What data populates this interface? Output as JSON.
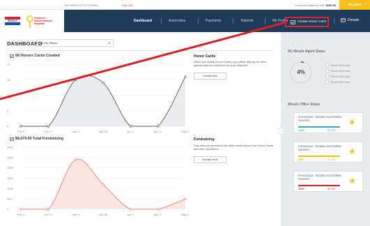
{
  "topbar": {
    "system_label": "THE MIRACLE SYSTEM",
    "lang": "HL",
    "signout": "Sign Out",
    "balance_label": "Combined Balance Due:",
    "balance_value": "$100.00",
    "paynow": "Pay Now"
  },
  "brand": {
    "remax": "RE/MAX",
    "cmn": "Children's Miracle Network Hospitals"
  },
  "nav": {
    "items": [
      "Dashboard",
      "Associates",
      "Payments",
      "Reports",
      "My Profile"
    ],
    "create_honor": "Create Honor Card",
    "donate": "Donate"
  },
  "main": {
    "title": "DASHBOARD",
    "office_select": "All My Offices",
    "chart1_title": "68 Honors Cards Created",
    "chart2_title": "$6,679.00 Total Fundraising",
    "honor_heading": "Honor Cards",
    "honor_text": "When you create Honor Cards, your office will pay for them upfront and then add them to your office bill.",
    "honor_button": "Create Now",
    "fund_heading": "Fundraising",
    "fund_text": "This amount represents the total contributions from Honor Cards and other donations.",
    "fund_button": "Donate Now"
  },
  "chart_data": [
    {
      "type": "line",
      "title": "68 Honors Cards Created",
      "categories": [
        "Feb 2",
        "Feb 17",
        "Mar 3",
        "Mar 18",
        "Apr 2",
        "Apr 17",
        "May 2"
      ],
      "values": [
        0,
        0,
        15,
        14,
        0,
        0,
        16
      ],
      "yticks": [
        0,
        5,
        10,
        15,
        20
      ],
      "ylim": [
        0,
        20
      ],
      "color": "#555555",
      "fill": "#e9edf2"
    },
    {
      "type": "line",
      "title": "$6,679.00 Total Fundraising",
      "categories": [
        "Feb 2",
        "Feb 17",
        "Mar 3",
        "Mar 18",
        "Apr 2",
        "Apr 17",
        "May 2"
      ],
      "values": [
        0,
        0,
        2400,
        1200,
        0,
        0,
        500
      ],
      "yticks": [
        0,
        500,
        1000,
        1500,
        2000,
        2500,
        3000
      ],
      "ylim": [
        0,
        3000
      ],
      "color": "#f27b6b",
      "fill": "#fde7e2"
    }
  ],
  "agent_status": {
    "heading": "My Miracle Agent Status",
    "percent": "4%",
    "percent_value": 4,
    "goals": [
      "Reach $100 total",
      "Reach $200 total",
      "Reach $300 total",
      "Reach $500 total"
    ]
  },
  "office_status": {
    "heading": "Miracle Office Status",
    "offices": [
      {
        "id": "R0470339 - RE/MAX SOUTHERN SHORES",
        "pct": "100%",
        "amt": "$2,000",
        "color": "#3aa3d9"
      },
      {
        "id": "R0470282 - RE/MAX SOUTHERN SHORES",
        "pct": "100%",
        "amt": "$2,000",
        "color": "#f6c21a"
      },
      {
        "id": "R0470443 - RE/MAX SOUTHERN SHORES",
        "pct": "100%",
        "amt": "$2,000",
        "color": "#e2222c"
      }
    ]
  },
  "colors": {
    "nav_bg": "#203a59",
    "accent_red": "#e2222c",
    "star": "#f4c21c",
    "paynow": "#f6c21a"
  }
}
